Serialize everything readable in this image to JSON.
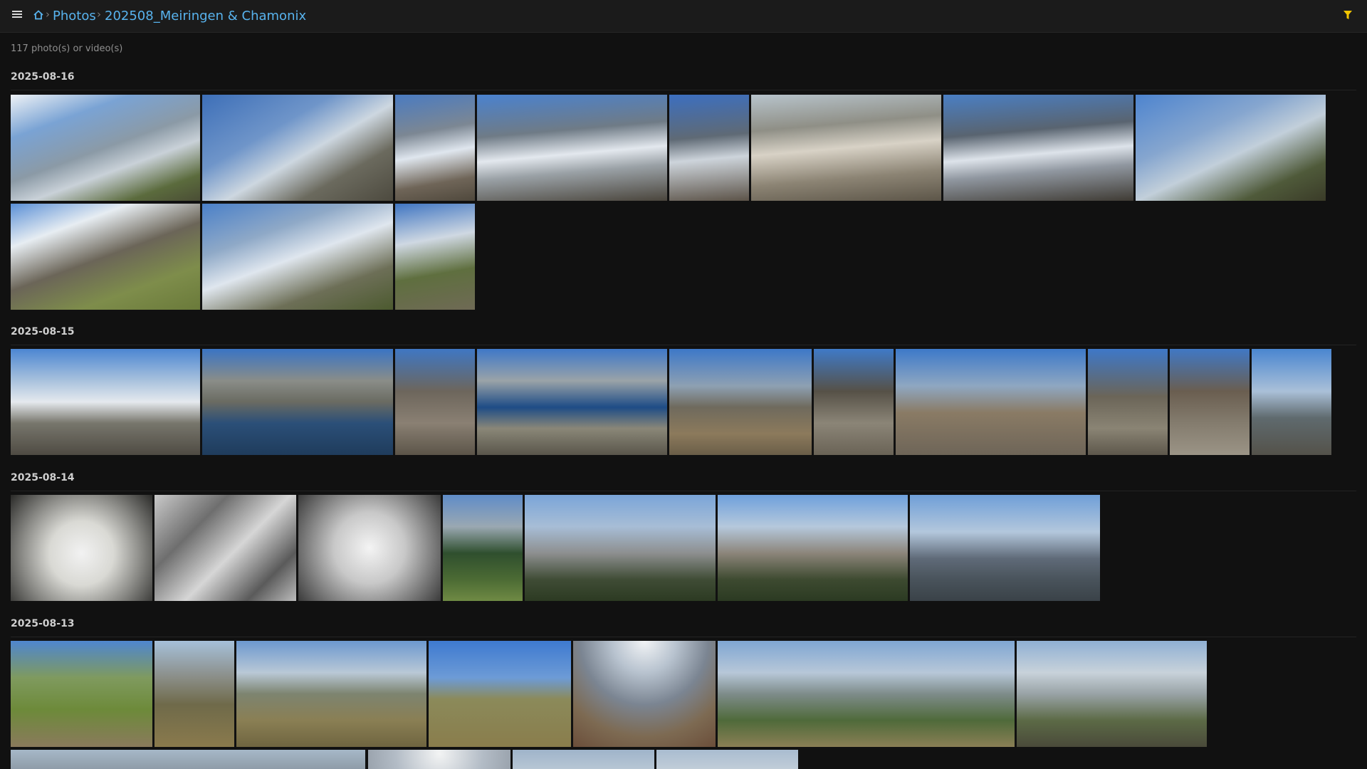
{
  "topbar": {
    "menu_icon": "hamburger-menu-icon",
    "home_icon": "home-icon",
    "filter_icon": "filter-icon",
    "filter_color": "#f2c500",
    "breadcrumb": [
      "Photos",
      "202508_Meiringen & Chamonix"
    ],
    "link_color": "#58b3ee"
  },
  "summary": {
    "count_text": "117 photo(s) or video(s)"
  },
  "groups": [
    {
      "date": "2025-08-16"
    },
    {
      "date": "2025-08-15"
    },
    {
      "date": "2025-08-14"
    },
    {
      "date": "2025-08-13"
    }
  ]
}
